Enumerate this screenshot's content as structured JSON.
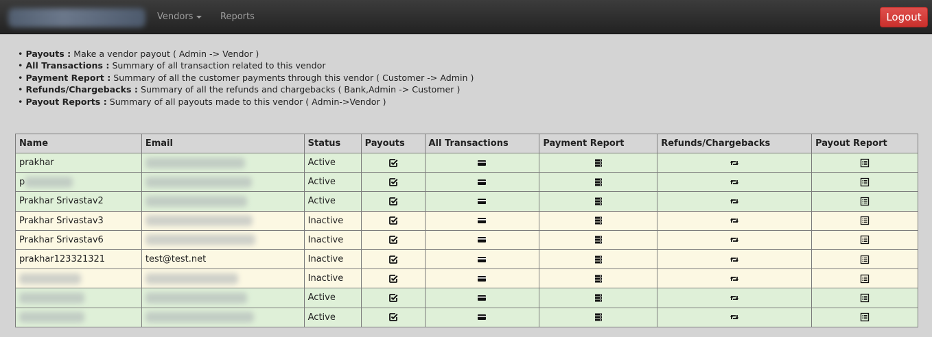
{
  "nav": {
    "vendors": "Vendors",
    "reports": "Reports",
    "logout": "Logout"
  },
  "legend": [
    {
      "term": "Payouts :",
      "desc": "Make a vendor payout ( Admin -> Vendor )"
    },
    {
      "term": "All Transactions :",
      "desc": "Summary of all transaction related to this vendor"
    },
    {
      "term": "Payment Report :",
      "desc": "Summary of all the customer payments through this vendor ( Customer -> Admin )"
    },
    {
      "term": "Refunds/Chargebacks :",
      "desc": "Summary of all the refunds and chargebacks ( Bank,Admin -> Customer )"
    },
    {
      "term": "Payout Reports :",
      "desc": "Summary of all payouts made to this vendor ( Admin->Vendor )"
    }
  ],
  "table": {
    "headers": [
      "Name",
      "Email",
      "Status",
      "Payouts",
      "All Transactions",
      "Payment Report",
      "Refunds/Chargebacks",
      "Payout Report"
    ],
    "rows": [
      {
        "name": "prakhar",
        "email": "",
        "status": "Active"
      },
      {
        "name": "p",
        "email": "",
        "status": "Active"
      },
      {
        "name": "Prakhar Srivastav2",
        "email": "",
        "status": "Active"
      },
      {
        "name": "Prakhar Srivastav3",
        "email": "",
        "status": "Inactive"
      },
      {
        "name": "Prakhar Srivastav6",
        "email": "",
        "status": "Inactive"
      },
      {
        "name": "prakhar123321321",
        "email": "test@test.net",
        "status": "Inactive"
      },
      {
        "name": "",
        "email": "",
        "status": "Inactive"
      },
      {
        "name": "",
        "email": "",
        "status": "Active"
      },
      {
        "name": "",
        "email": "",
        "status": "Active"
      }
    ]
  },
  "icons": {
    "payouts": "check-square-icon",
    "all_transactions": "credit-card-icon",
    "payment_report": "server-icon",
    "refunds": "retweet-icon",
    "payout_report": "list-alt-icon"
  }
}
